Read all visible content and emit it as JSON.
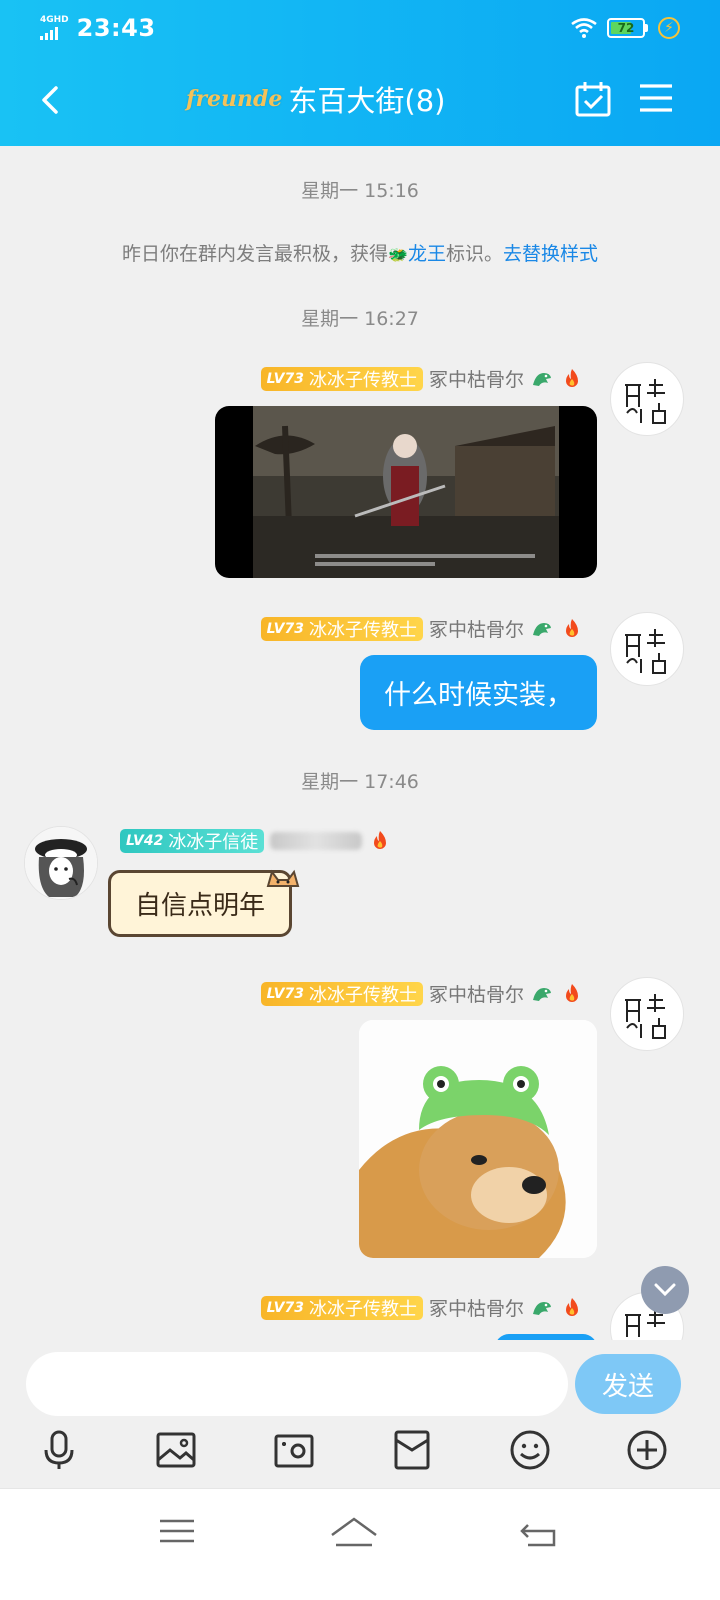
{
  "status": {
    "network": "4GHD",
    "time": "23:43",
    "battery": "72",
    "battery_level": 0.72
  },
  "header": {
    "logo_text": "freunde",
    "title": "东百大街(8)"
  },
  "messages": {
    "ts1": "星期一 15:16",
    "sys": {
      "prefix": "昨日你在群内发言最积极，获得",
      "badge": "龙王",
      "suffix": "标识。",
      "link": "去替换样式"
    },
    "ts2": "星期一 16:27",
    "ts3": "星期一 17:46",
    "sender_self": {
      "level": "LV73",
      "rank": "冰冰子传教士",
      "name": "冢中枯骨尔"
    },
    "sender_other": {
      "level": "LV42",
      "rank": "冰冰子信徒"
    },
    "text_self": "什么时候实装，",
    "text_other": "自信点明年"
  },
  "input": {
    "placeholder": "",
    "send_label": "发送"
  },
  "icons": {
    "toolbar": [
      "microphone-icon",
      "image-icon",
      "camera-icon",
      "red-packet-icon",
      "emoji-icon",
      "plus-icon"
    ],
    "nav": [
      "menu-icon",
      "home-icon",
      "back-icon"
    ]
  },
  "colors": {
    "header": "#12b6f4",
    "bubble_self": "#1aa0f5",
    "send_button": "#7ec8f6",
    "link": "#1a88e6"
  }
}
